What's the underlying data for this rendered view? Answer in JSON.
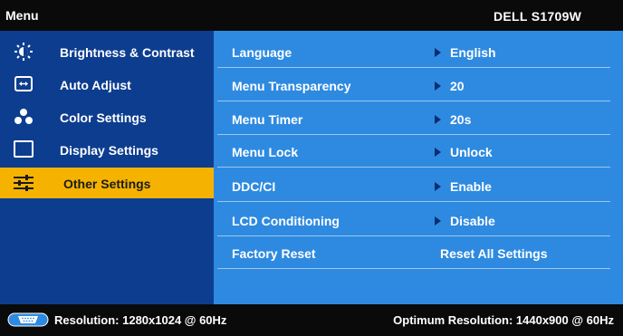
{
  "header": {
    "title": "Menu",
    "model": "DELL S1709W"
  },
  "sidebar": {
    "items": [
      {
        "label": "Brightness & Contrast",
        "icon": "brightness-icon"
      },
      {
        "label": "Auto Adjust",
        "icon": "auto-adjust-icon"
      },
      {
        "label": "Color Settings",
        "icon": "color-settings-icon"
      },
      {
        "label": "Display Settings",
        "icon": "display-settings-icon"
      },
      {
        "label": "Other Settings",
        "icon": "other-settings-icon",
        "active": true
      }
    ]
  },
  "settings": {
    "rows": [
      {
        "label": "Language",
        "value": "English"
      },
      {
        "label": "Menu Transparency",
        "value": "20"
      },
      {
        "label": "Menu Timer",
        "value": "20s"
      },
      {
        "label": "Menu Lock",
        "value": "Unlock"
      },
      {
        "label": "DDC/CI",
        "value": "Enable"
      },
      {
        "label": "LCD Conditioning",
        "value": "Disable"
      },
      {
        "label": "Factory Reset",
        "value": "Reset All Settings"
      }
    ]
  },
  "footer": {
    "resolution": "Resolution: 1280x1024 @ 60Hz",
    "optimum": "Optimum Resolution: 1440x900 @ 60Hz"
  },
  "colors": {
    "sidebar_bg": "#0d3d8f",
    "panel_bg": "#2e8ae0",
    "active_bg": "#f5b300",
    "bar_bg": "#0a0a0a"
  }
}
